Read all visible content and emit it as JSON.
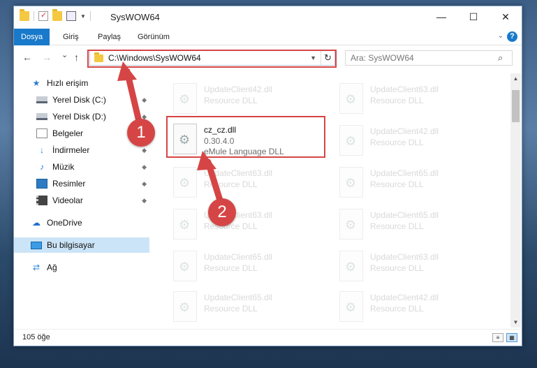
{
  "window": {
    "title": "SysWOW64",
    "minimize": "—",
    "maximize": "☐",
    "close": "✕"
  },
  "ribbon": {
    "tabs": [
      "Dosya",
      "Giriş",
      "Paylaş",
      "Görünüm"
    ],
    "active_tab": "Dosya",
    "expand_icon": "chevron-down-icon",
    "help_label": "?"
  },
  "nav": {
    "back": "←",
    "forward": "→",
    "recent": "⌄",
    "up": "↑",
    "address": "C:\\Windows\\SysWOW64",
    "refresh": "↻",
    "search_placeholder": "Ara: SysWOW64",
    "search_icon": "⌕"
  },
  "sidebar": {
    "items": [
      {
        "label": "Hızlı erişim",
        "icon": "★",
        "pinned": false
      },
      {
        "label": "Yerel Disk (C:)",
        "icon": "",
        "pinned": true
      },
      {
        "label": "Yerel Disk (D:)",
        "icon": "",
        "pinned": true
      },
      {
        "label": "Belgeler",
        "icon": "",
        "pinned": true
      },
      {
        "label": "İndirmeler",
        "icon": "↓",
        "pinned": true
      },
      {
        "label": "Müzik",
        "icon": "♪",
        "pinned": true
      },
      {
        "label": "Resimler",
        "icon": "",
        "pinned": true
      },
      {
        "label": "Videolar",
        "icon": "",
        "pinned": true
      },
      {
        "label": "OneDrive",
        "icon": "☁",
        "pinned": false
      },
      {
        "label": "Bu bilgisayar",
        "icon": "",
        "pinned": false
      },
      {
        "label": "Ağ",
        "icon": "⇄",
        "pinned": false
      }
    ],
    "pin_glyph": "📌",
    "selected": "Bu bilgisayar"
  },
  "files": [
    {
      "name": "UpdateClient42.dll",
      "meta1": "Resource DLL",
      "meta2": ""
    },
    {
      "name": "UpdateClient63.dll",
      "meta1": "Resource DLL",
      "meta2": ""
    },
    {
      "name": "cz_cz.dll",
      "meta1": "0.30.4.0",
      "meta2": "eMule Language DLL"
    },
    {
      "name": "UpdateClient42.dll",
      "meta1": "Resource DLL",
      "meta2": ""
    },
    {
      "name": "UpdateClient63.dll",
      "meta1": "Resource DLL",
      "meta2": ""
    },
    {
      "name": "UpdateClient65.dll",
      "meta1": "Resource DLL",
      "meta2": ""
    },
    {
      "name": "UpdateClient63.dll",
      "meta1": "Resource DLL",
      "meta2": ""
    },
    {
      "name": "UpdateClient65.dll",
      "meta1": "Resource DLL",
      "meta2": ""
    },
    {
      "name": "UpdateClient65.dll",
      "meta1": "Resource DLL",
      "meta2": ""
    },
    {
      "name": "UpdateClient63.dll",
      "meta1": "Resource DLL",
      "meta2": ""
    },
    {
      "name": "UpdateClient65.dll",
      "meta1": "Resource DLL",
      "meta2": ""
    },
    {
      "name": "UpdateClient42.dll",
      "meta1": "Resource DLL",
      "meta2": ""
    }
  ],
  "status": {
    "count": "105 öğe"
  },
  "callouts": {
    "step1": "1",
    "step2": "2",
    "color": "#d64545"
  }
}
